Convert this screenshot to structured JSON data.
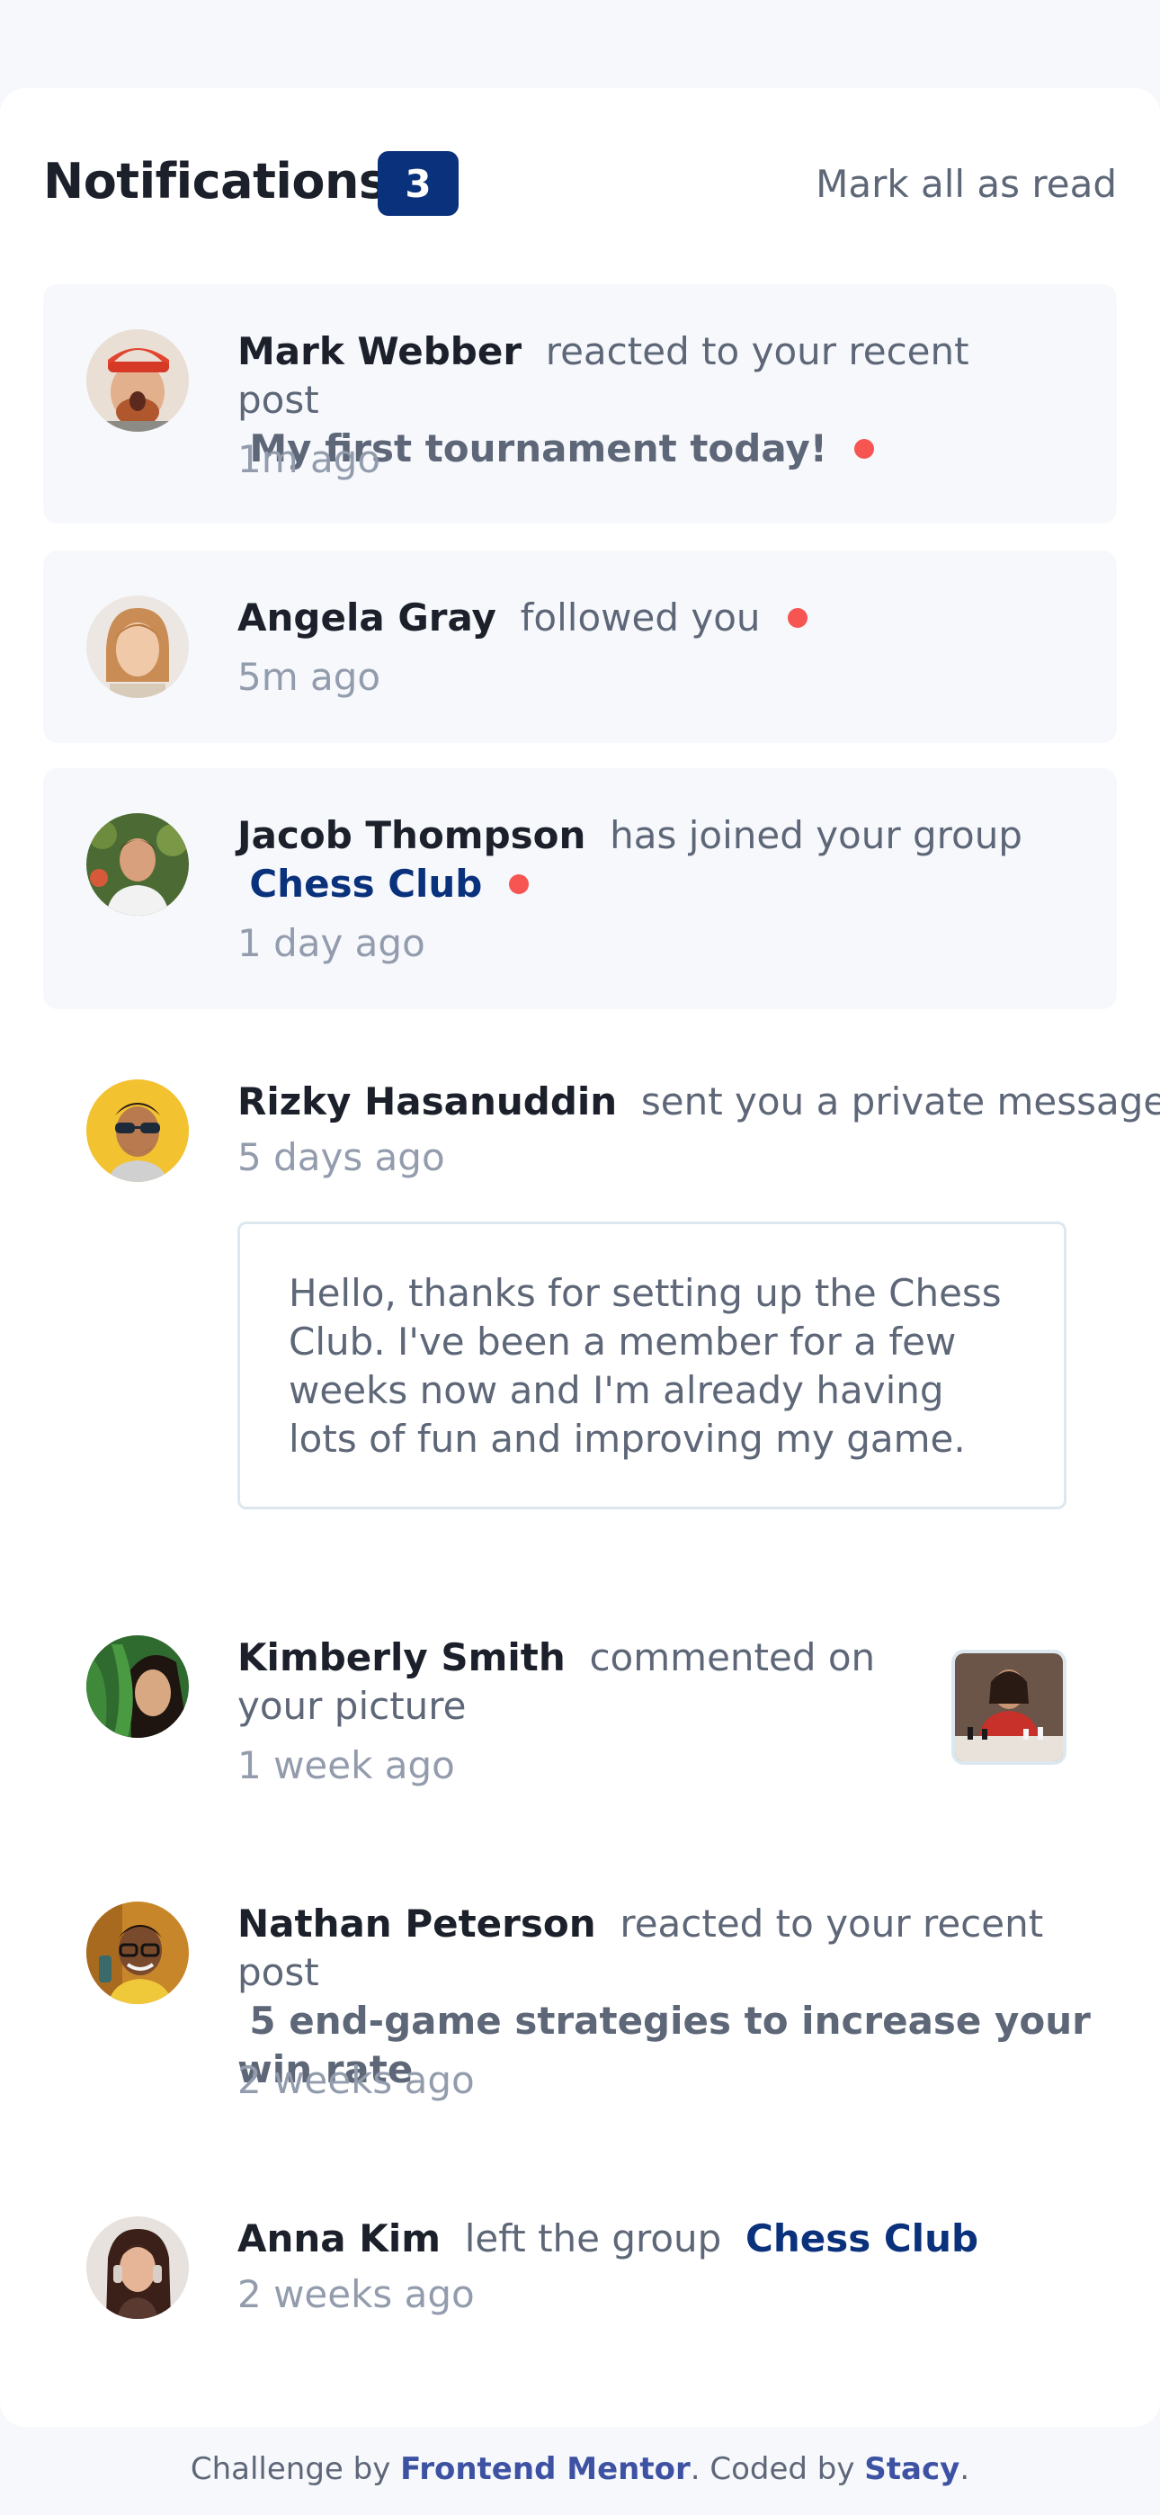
{
  "header": {
    "title": "Notifications",
    "unread_count": "3",
    "mark_all": "Mark all as read"
  },
  "notifications": [
    {
      "name": "Mark Webber",
      "action": "reacted to your recent post",
      "post": "My first tournament today!",
      "time": "1m ago",
      "unread": true
    },
    {
      "name": "Angela Gray",
      "action": "followed you",
      "time": "5m ago",
      "unread": true
    },
    {
      "name": "Jacob Thompson",
      "action": "has joined your group",
      "group": "Chess Club",
      "time": "1 day ago",
      "unread": true
    },
    {
      "name": "Rizky Hasanuddin",
      "action": "sent you a private message",
      "time": "5 days ago",
      "message": "Hello, thanks for setting up the Chess Club. I've been a member for a few weeks now and I'm already having lots of fun and improving my game.",
      "unread": false
    },
    {
      "name": "Kimberly Smith",
      "action": "commented on your picture",
      "time": "1 week ago",
      "unread": false
    },
    {
      "name": "Nathan Peterson",
      "action": "reacted to your recent post",
      "post": "5 end-game strategies to increase your win rate",
      "time": "2 weeks ago",
      "unread": false
    },
    {
      "name": "Anna Kim",
      "action": "left the group",
      "group": "Chess Club",
      "time": "2 weeks ago",
      "unread": false
    }
  ],
  "footer": {
    "prefix": "Challenge by",
    "link1": "Frontend Mentor",
    "middle": ". Coded by",
    "link2": "Stacy",
    "suffix": "."
  },
  "colors": {
    "unread_bg": "#f6f8fc",
    "accent_blue": "#0a317b",
    "red_dot": "#f65552",
    "name_text": "#1c202b",
    "body_text": "#5e6778",
    "muted_text": "#939cad"
  },
  "icons": {
    "unread": "red-dot-indicator"
  }
}
